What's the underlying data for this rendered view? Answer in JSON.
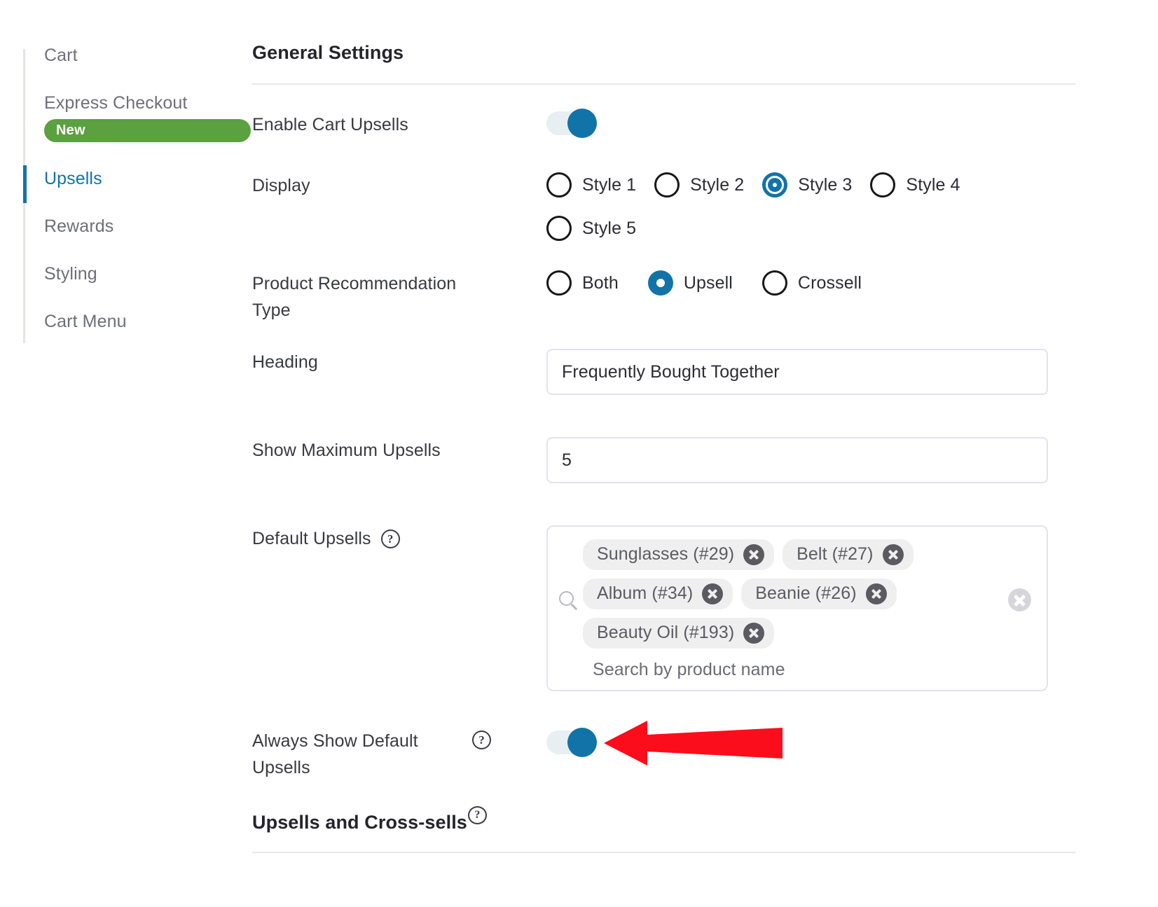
{
  "sidebar": {
    "items": [
      {
        "label": "Cart",
        "active": false,
        "badge": null
      },
      {
        "label": "Express Checkout",
        "active": false,
        "badge": "New"
      },
      {
        "label": "Upsells",
        "active": true,
        "badge": null
      },
      {
        "label": "Rewards",
        "active": false,
        "badge": null
      },
      {
        "label": "Styling",
        "active": false,
        "badge": null
      },
      {
        "label": "Cart Menu",
        "active": false,
        "badge": null
      }
    ]
  },
  "main": {
    "section_title": "General Settings",
    "enable_upsells": {
      "label": "Enable Cart Upsells",
      "value": "on"
    },
    "display": {
      "label": "Display",
      "options": [
        "Style 1",
        "Style 2",
        "Style 3",
        "Style 4",
        "Style 5"
      ],
      "selected": "Style 3"
    },
    "recommendation_type": {
      "label": "Product Recommendation Type",
      "options": [
        "Both",
        "Upsell",
        "Crossell"
      ],
      "selected": "Upsell"
    },
    "heading_field": {
      "label": "Heading",
      "value": "Frequently Bought Together",
      "placeholder": ""
    },
    "max_upsells": {
      "label": "Show Maximum Upsells",
      "value": "5",
      "placeholder": ""
    },
    "default_upsells": {
      "label": "Default Upsells",
      "help": "?",
      "chips": [
        "Sunglasses (#29)",
        "Belt (#27)",
        "Album (#34)",
        "Beanie (#26)",
        "Beauty Oil (#193)"
      ],
      "placeholder": "Search by product name",
      "search_icon": "search-icon",
      "clear_icon": "clear-all-icon"
    },
    "always_show": {
      "label": "Always Show Default Upsells",
      "help": "?",
      "value": "on"
    },
    "bottom_heading": {
      "text": "Upsells and Cross-sells",
      "help": "?"
    }
  },
  "annotation": {
    "arrow_color": "#fc0d1c",
    "arrow_name": "red-pointer-arrow"
  },
  "colors": {
    "accent": "#1273a8",
    "badge_green": "#5ba13f",
    "text_dark": "#24242b",
    "text_muted": "#6f6f7a",
    "border": "#e3e3ee",
    "chip_bg": "#efefef"
  }
}
